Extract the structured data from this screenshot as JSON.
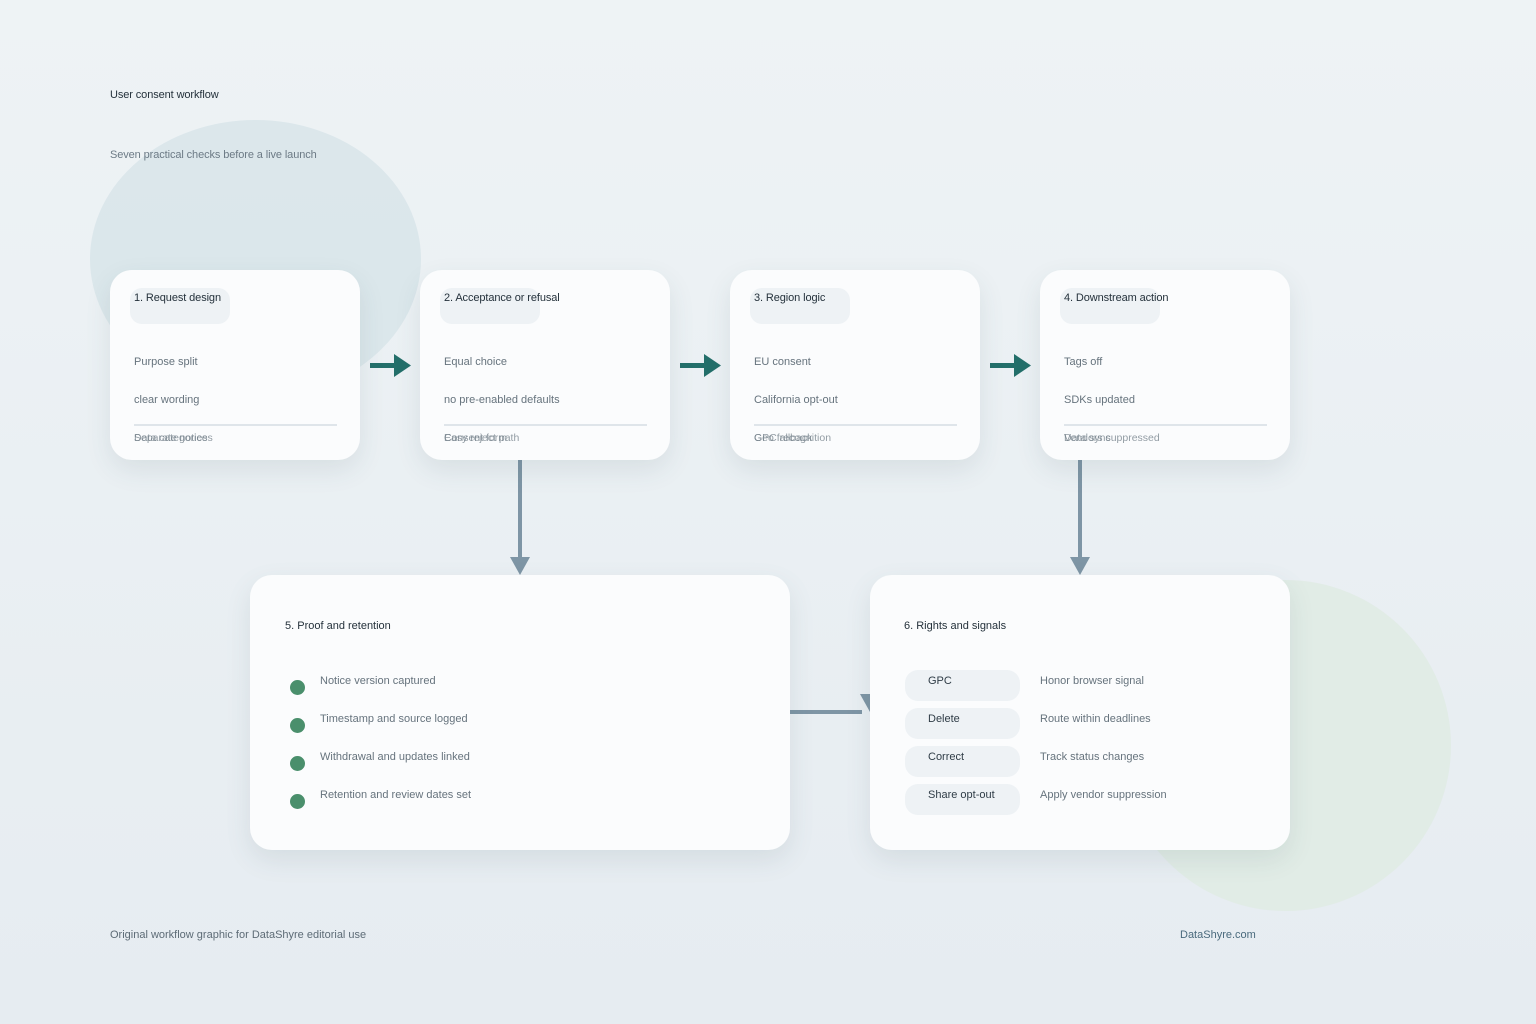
{
  "header": {
    "title": "User consent workflow",
    "subtitle": "Seven practical checks before a live launch"
  },
  "colors": {
    "flow_arrow": "#236f6a",
    "down_arrow": "#7e95a5",
    "check_dot": "#4a8f6c"
  },
  "steps": [
    {
      "title": "1. Request design",
      "line1": "Purpose split",
      "line2": "clear wording",
      "foot_a": "Separate notices",
      "foot_b": "Data categories"
    },
    {
      "title": "2. Acceptance or refusal",
      "line1": "Equal choice",
      "line2": "no pre-enabled defaults",
      "foot_a": "Easy reject path",
      "foot_b": "Consent form"
    },
    {
      "title": "3. Region logic",
      "line1": "EU consent",
      "line2": "California opt-out",
      "foot_a": "GPC recognition",
      "foot_b": "Geo fallback"
    },
    {
      "title": "4. Downstream action",
      "line1": "Tags off",
      "line2": "SDKs updated",
      "foot_a": "Vendors suppressed",
      "foot_b": "Data sync"
    }
  ],
  "proof": {
    "title": "5. Proof and retention",
    "items": [
      "Notice version captured",
      "Timestamp and source logged",
      "Withdrawal and updates linked",
      "Retention and review dates set"
    ]
  },
  "rights": {
    "title": "6. Rights and signals",
    "rows": [
      {
        "chip": "GPC",
        "text": "Honor browser signal"
      },
      {
        "chip": "Delete",
        "text": "Route within deadlines"
      },
      {
        "chip": "Correct",
        "text": "Track status changes"
      },
      {
        "chip": "Share opt-out",
        "text": "Apply vendor suppression"
      }
    ]
  },
  "footer": {
    "note": "Original workflow graphic for DataShyre editorial use",
    "brand": "DataShyre.com"
  }
}
